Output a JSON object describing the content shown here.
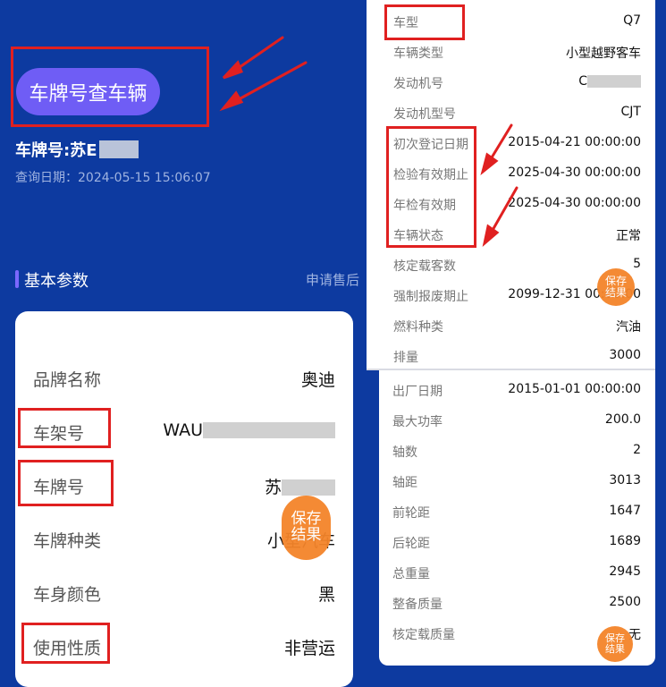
{
  "left": {
    "search_button": "车牌号查车辆",
    "plate_title": "车牌号:苏E",
    "query_date": "查询日期：2024-05-15 15:06:07",
    "section_title": "基本参数",
    "section_link": "申请售后",
    "rows": [
      {
        "label": "品牌名称",
        "value": "奥迪"
      },
      {
        "label": "车架号",
        "value": "WAU"
      },
      {
        "label": "车牌号",
        "value": "苏"
      },
      {
        "label": "车牌种类",
        "value": "小型汽车"
      },
      {
        "label": "车身颜色",
        "value": "黑"
      },
      {
        "label": "使用性质",
        "value": "非营运"
      }
    ],
    "save_label": "保存\n结果"
  },
  "right_top": {
    "rows": [
      {
        "label": "车型",
        "value": "Q7"
      },
      {
        "label": "车辆类型",
        "value": "小型越野客车"
      },
      {
        "label": "发动机号",
        "value": "C"
      },
      {
        "label": "发动机型号",
        "value": "CJT"
      },
      {
        "label": "初次登记日期",
        "value": "2015-04-21 00:00:00"
      },
      {
        "label": "检验有效期止",
        "value": "2025-04-30 00:00:00"
      },
      {
        "label": "年检有效期",
        "value": "2025-04-30 00:00:00"
      },
      {
        "label": "车辆状态",
        "value": "正常"
      },
      {
        "label": "核定载客数",
        "value": "5"
      },
      {
        "label": "强制报废期止",
        "value": "2099-12-31 00:00:00"
      },
      {
        "label": "燃料种类",
        "value": "汽油"
      },
      {
        "label": "排量",
        "value": "3000"
      }
    ],
    "save_label": "保存\n结果"
  },
  "right_bottom": {
    "rows": [
      {
        "label": "出厂日期",
        "value": "2015-01-01 00:00:00"
      },
      {
        "label": "最大功率",
        "value": "200.0"
      },
      {
        "label": "轴数",
        "value": "2"
      },
      {
        "label": "轴距",
        "value": "3013"
      },
      {
        "label": "前轮距",
        "value": "1647"
      },
      {
        "label": "后轮距",
        "value": "1689"
      },
      {
        "label": "总重量",
        "value": "2945"
      },
      {
        "label": "整备质量",
        "value": "2500"
      },
      {
        "label": "核定载质量",
        "value": "无"
      }
    ],
    "save_label": "保存\n结果"
  },
  "colors": {
    "background": "#0d3aa0",
    "accent": "#6f5df5",
    "highlight": "#e02020",
    "fab": "#f4842a"
  }
}
